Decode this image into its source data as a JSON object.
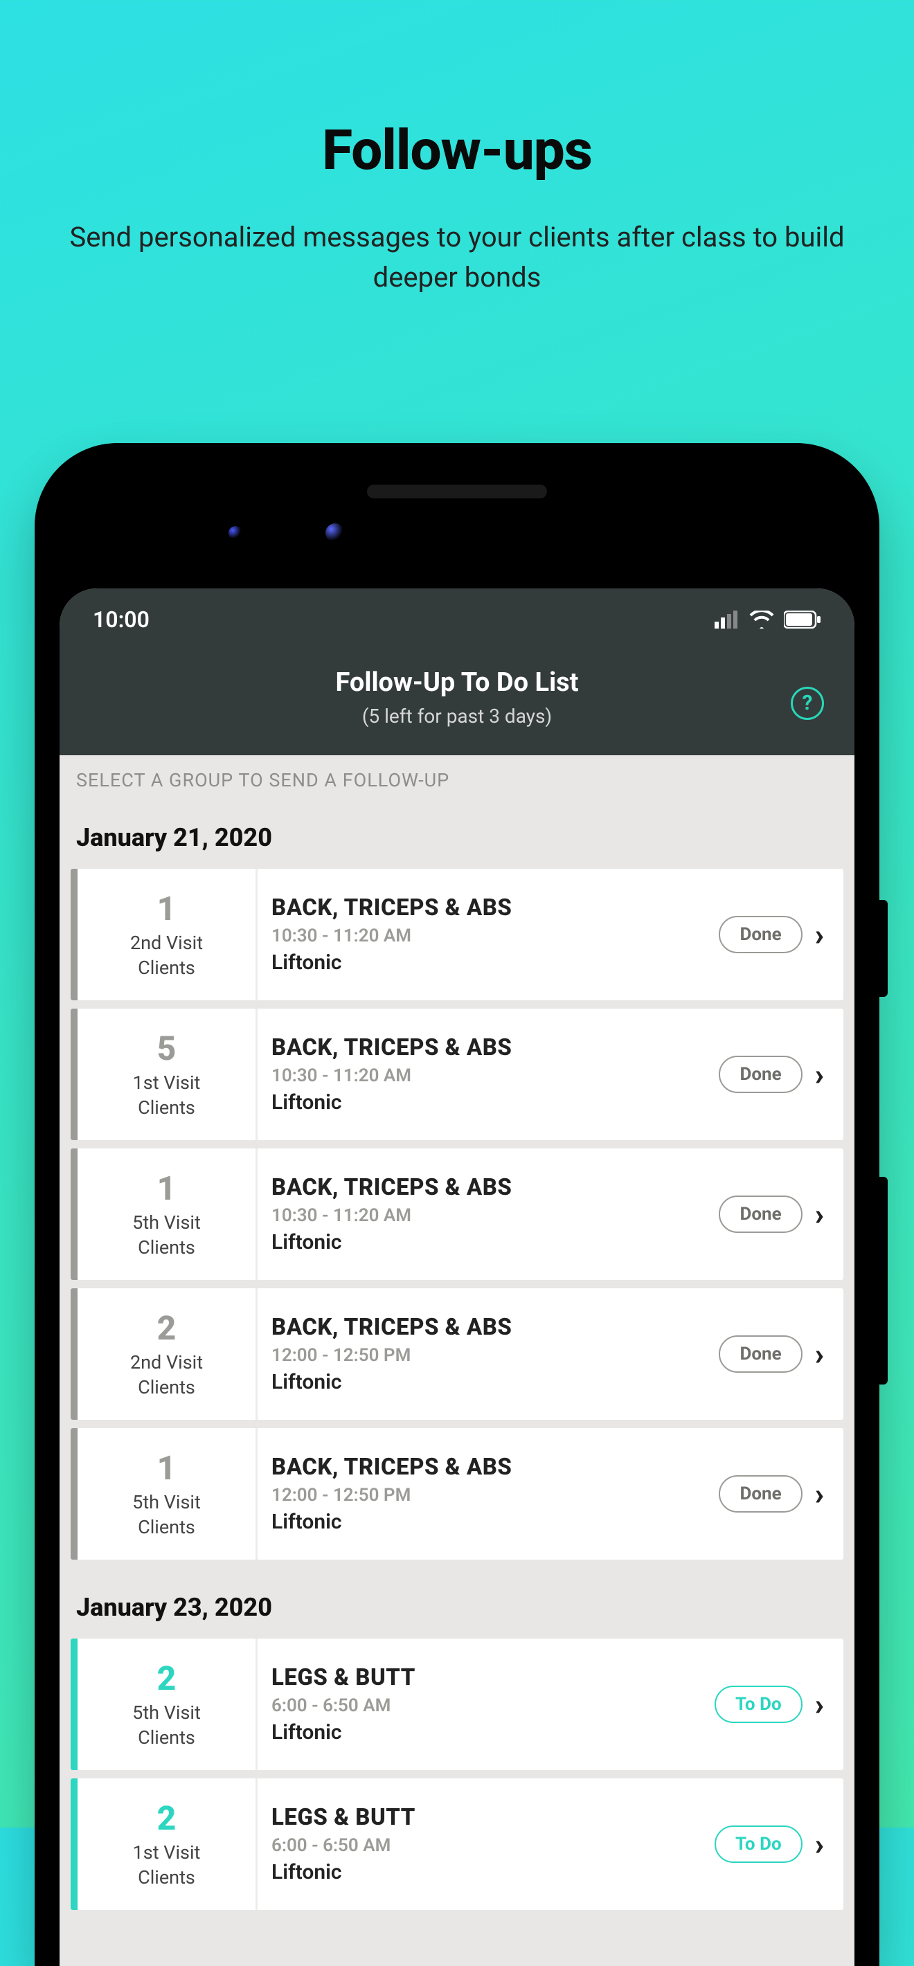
{
  "page": {
    "title": "Follow-ups",
    "subtitle": "Send personalized messages to your clients after class to build deeper bonds"
  },
  "statusbar": {
    "time": "10:00"
  },
  "header": {
    "title": "Follow-Up To Do List",
    "subtitle": "(5 left for past 3 days)"
  },
  "hint": "SELECT A GROUP TO SEND A FOLLOW-UP",
  "groups": [
    {
      "date": "January 21, 2020",
      "items": [
        {
          "count": "1",
          "visit_label": "2nd Visit\nClients",
          "class": "BACK, TRICEPS & ABS",
          "time": "10:30 - 11:20 AM",
          "location": "Liftonic",
          "status": "Done"
        },
        {
          "count": "5",
          "visit_label": "1st Visit\nClients",
          "class": "BACK, TRICEPS & ABS",
          "time": "10:30 - 11:20 AM",
          "location": "Liftonic",
          "status": "Done"
        },
        {
          "count": "1",
          "visit_label": "5th Visit\nClients",
          "class": "BACK, TRICEPS & ABS",
          "time": "10:30 - 11:20 AM",
          "location": "Liftonic",
          "status": "Done"
        },
        {
          "count": "2",
          "visit_label": "2nd Visit\nClients",
          "class": "BACK, TRICEPS & ABS",
          "time": "12:00 - 12:50 PM",
          "location": "Liftonic",
          "status": "Done"
        },
        {
          "count": "1",
          "visit_label": "5th Visit\nClients",
          "class": "BACK, TRICEPS & ABS",
          "time": "12:00 - 12:50 PM",
          "location": "Liftonic",
          "status": "Done"
        }
      ]
    },
    {
      "date": "January 23, 2020",
      "items": [
        {
          "count": "2",
          "visit_label": "5th Visit\nClients",
          "class": "LEGS & BUTT",
          "time": "6:00 - 6:50 AM",
          "location": "Liftonic",
          "status": "To Do"
        },
        {
          "count": "2",
          "visit_label": "1st Visit\nClients",
          "class": "LEGS & BUTT",
          "time": "6:00 - 6:50 AM",
          "location": "Liftonic",
          "status": "To Do"
        }
      ]
    }
  ]
}
